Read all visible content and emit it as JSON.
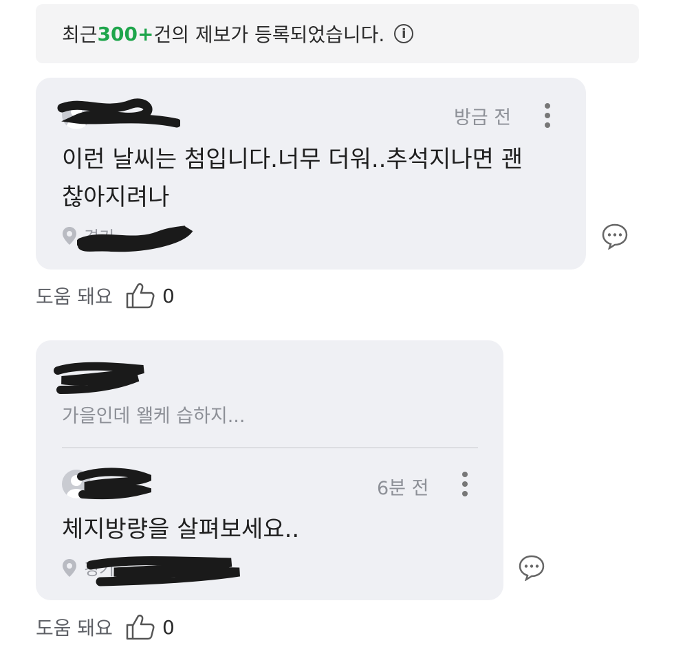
{
  "notice": {
    "prefix": "최근 ",
    "count": "300+",
    "suffix": "건의 제보가 등록되었습니다.",
    "info_icon": "info-circle-icon"
  },
  "post1": {
    "time": "방금 전",
    "text": "이런 날씨는 첨입니다.너무 더워..추석지나면 괜찮아지려나",
    "location": "경기 ",
    "helpful_label": "도움 돼요",
    "helpful_count": "0"
  },
  "post2": {
    "parent_preview": "가을인데 왤케 습하지...",
    "reply_time": "6분 전",
    "reply_text": "체지방량을 살펴보세요..",
    "location": "경기",
    "helpful_label": "도움 돼요",
    "helpful_count": "0"
  },
  "colors": {
    "accent": "#1ea54b",
    "card_bg": "#eff0f4",
    "notice_bg": "#f4f4f5"
  }
}
